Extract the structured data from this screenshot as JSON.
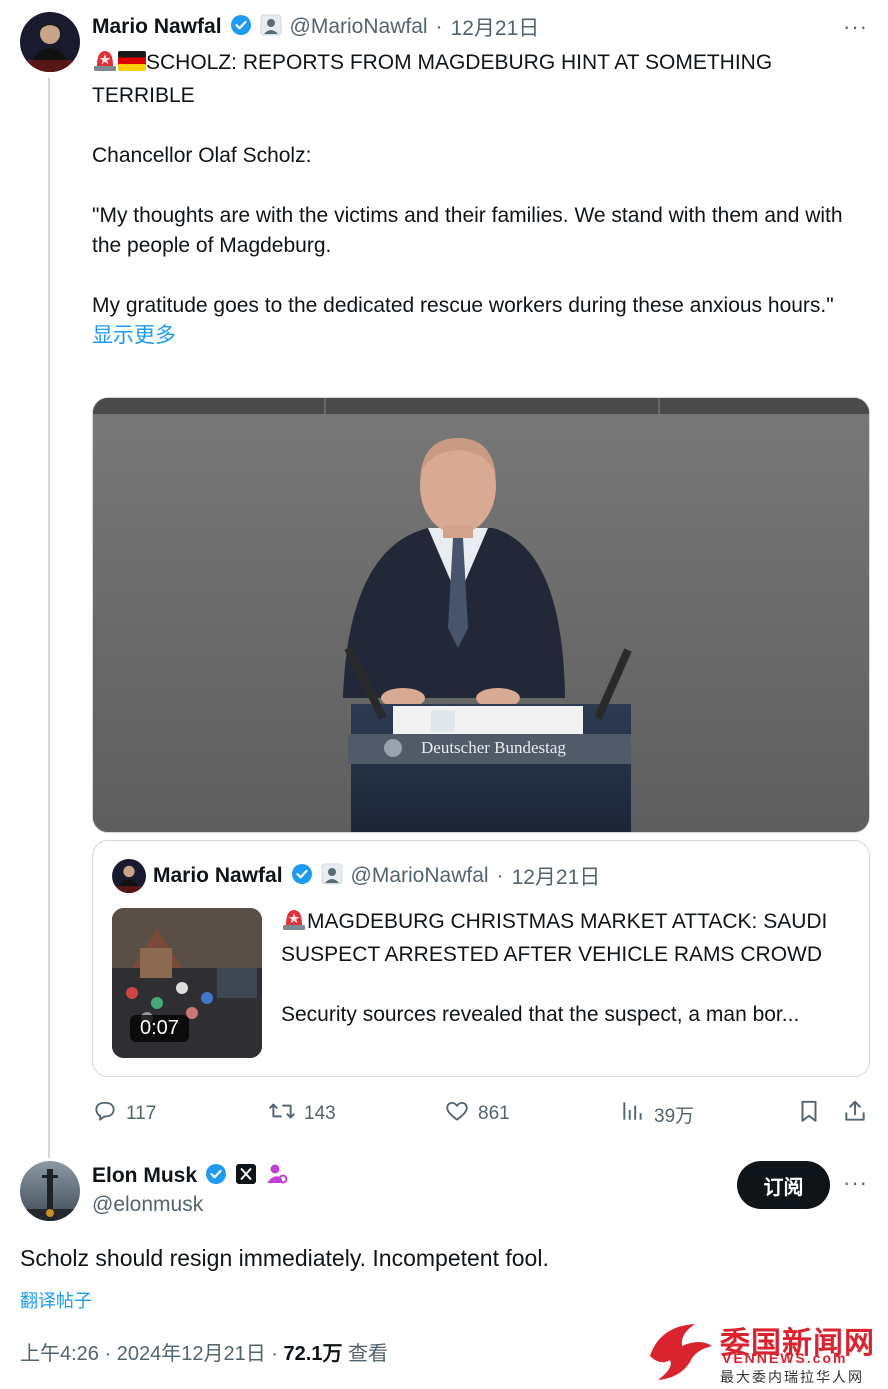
{
  "tweet": {
    "author_name": "Mario Nawfal",
    "author_handle": "@MarioNawfal",
    "sep": "·",
    "date": "12月21日",
    "headline": "SCHOLZ: REPORTS FROM MAGDEBURG HINT AT SOMETHING TERRIBLE",
    "line_speaker": "Chancellor Olaf Scholz:",
    "quote_p1": "\"My thoughts are with the victims and their families. We stand with them and with the people of Magdeburg.",
    "quote_p2": "My gratitude goes to the dedicated rescue workers during these anxious hours.\"",
    "show_more": "显示更多",
    "media_caption": "Deutscher Bundestag",
    "more_icon": "···"
  },
  "quoted": {
    "author_name": "Mario Nawfal",
    "author_handle": "@MarioNawfal",
    "sep": "·",
    "date": "12月21日",
    "duration": "0:07",
    "headline": "MAGDEBURG CHRISTMAS MARKET ATTACK: SAUDI SUSPECT ARRESTED AFTER VEHICLE RAMS CROWD",
    "snippet": "Security sources revealed that the suspect, a man bor..."
  },
  "actions": {
    "replies": "117",
    "retweets": "143",
    "likes": "861",
    "views": "39万"
  },
  "reply": {
    "author_name": "Elon Musk",
    "author_handle": "@elonmusk",
    "subscribe_label": "订阅",
    "text": "Scholz should resign immediately. Incompetent fool.",
    "translate_label": "翻译帖子",
    "time": "上午4:26",
    "sep1": "·",
    "date": "2024年12月21日",
    "sep2": "·",
    "views_count": "72.1万",
    "views_label": "查看",
    "more_icon": "···"
  },
  "watermark": {
    "cn_title": "委国新闻网",
    "url": "VENNEWS.com",
    "subtitle": "最大委内瑞拉华人网"
  },
  "colors": {
    "accent": "#1d9bf0",
    "secondary_text": "#536471",
    "border": "#cfd9de",
    "brand_red": "#d9232f"
  }
}
